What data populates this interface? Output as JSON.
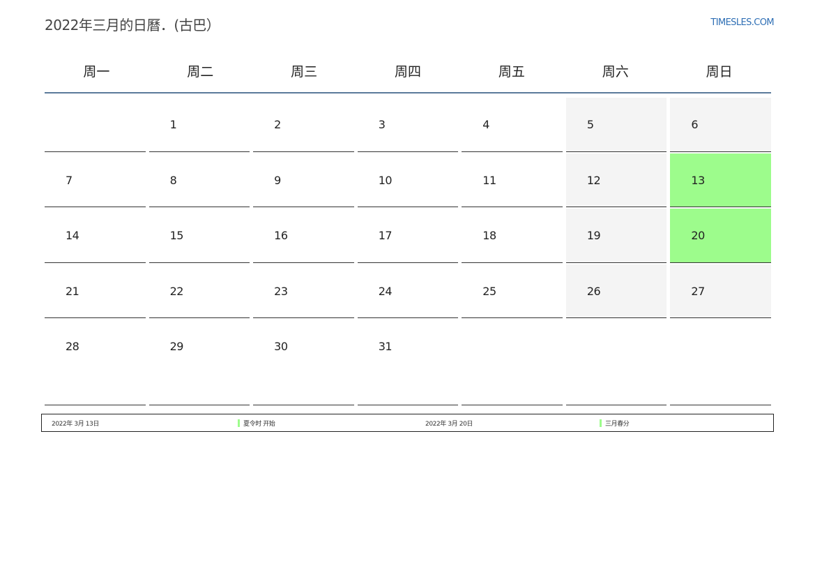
{
  "header": {
    "title": "2022年三月的日曆．(古巴）",
    "site_link": "TIMESLES.COM"
  },
  "calendar": {
    "weekdays": [
      "周一",
      "周二",
      "周三",
      "周四",
      "周五",
      "周六",
      "周日"
    ],
    "weeks": [
      [
        "",
        "1",
        "2",
        "3",
        "4",
        "5",
        "6"
      ],
      [
        "7",
        "8",
        "9",
        "10",
        "11",
        "12",
        "13"
      ],
      [
        "14",
        "15",
        "16",
        "17",
        "18",
        "19",
        "20"
      ],
      [
        "21",
        "22",
        "23",
        "24",
        "25",
        "26",
        "27"
      ],
      [
        "28",
        "29",
        "30",
        "31",
        "",
        "",
        ""
      ]
    ],
    "highlighted_days": [
      "13",
      "20"
    ],
    "colors": {
      "weekend_bg": "#f4f4f4",
      "highlight_bg": "#9dfc8c",
      "header_rule": "#5b7a9a",
      "link": "#2f6fb5"
    }
  },
  "legend": [
    {
      "date": "2022年 3月 13日",
      "event": "夏令时 开始"
    },
    {
      "date": "2022年 3月 20日",
      "event": "三月春分"
    }
  ]
}
